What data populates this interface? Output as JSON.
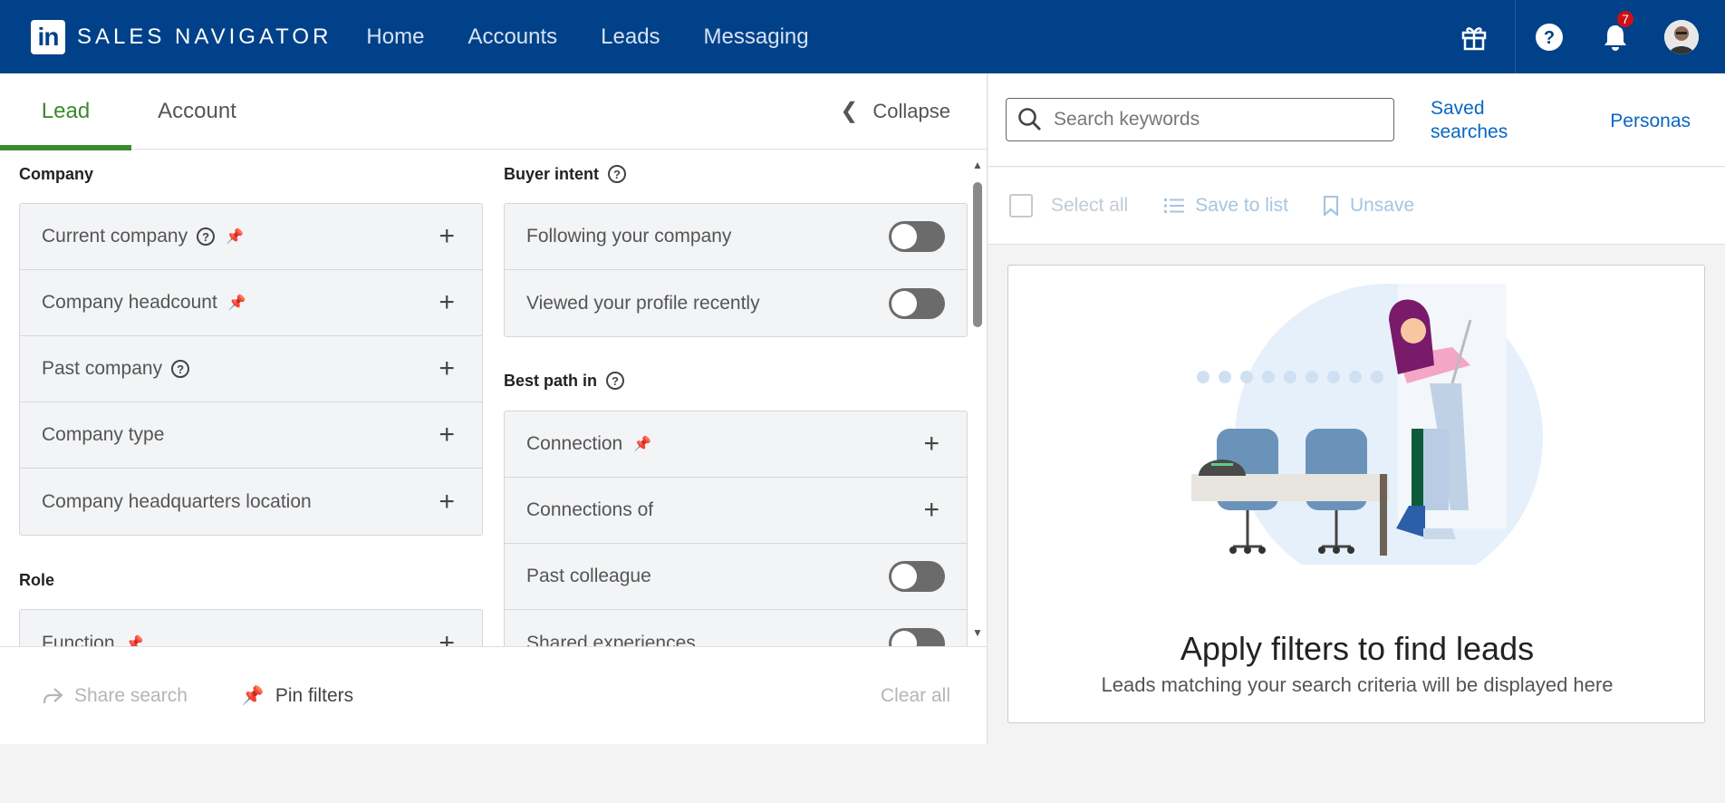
{
  "brand": {
    "logo_text": "in",
    "name": "SALES NAVIGATOR"
  },
  "nav": {
    "items": [
      "Home",
      "Accounts",
      "Leads",
      "Messaging"
    ]
  },
  "notifications": {
    "count": "7"
  },
  "tabs": [
    {
      "label": "Lead",
      "active": true
    },
    {
      "label": "Account",
      "active": false
    }
  ],
  "collapse_label": "Collapse",
  "left_column": {
    "company": {
      "title": "Company",
      "filters": [
        "Current company",
        "Company headcount",
        "Past company",
        "Company type",
        "Company headquarters location"
      ]
    },
    "role": {
      "title": "Role",
      "filters": [
        "Function"
      ]
    }
  },
  "right_column": {
    "buyer_intent": {
      "title": "Buyer intent",
      "toggles": [
        "Following your company",
        "Viewed your profile recently"
      ]
    },
    "best_path": {
      "title": "Best path in",
      "filters": [
        "Connection",
        "Connections of"
      ],
      "toggles": [
        "Past colleague",
        "Shared experiences"
      ]
    }
  },
  "footer": {
    "share": "Share search",
    "pin": "Pin filters",
    "clear": "Clear all"
  },
  "search": {
    "placeholder": "Search keywords",
    "saved_line1": "Saved",
    "saved_line2": "searches",
    "personas": "Personas"
  },
  "actions": {
    "select_all": "Select all",
    "save_to_list": "Save to list",
    "unsave": "Unsave"
  },
  "empty_state": {
    "title": "Apply filters to find leads",
    "subtitle": "Leads matching your search criteria will be displayed here"
  },
  "colors": {
    "nav_bg": "#00418a",
    "accent_green": "#3b8a2e",
    "link_blue": "#0a66c2",
    "badge_red": "#cc1016"
  }
}
